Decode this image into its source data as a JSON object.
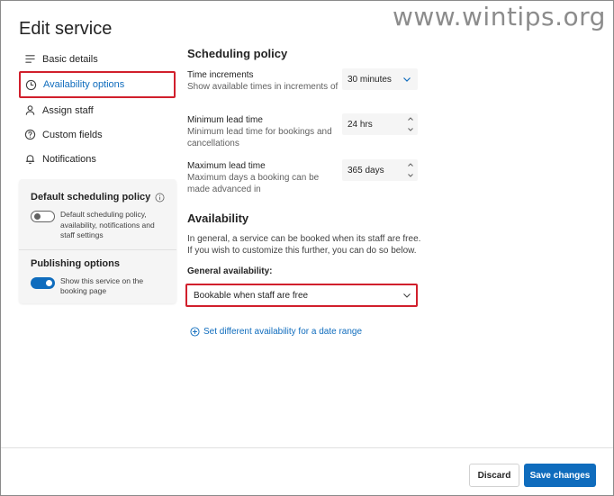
{
  "watermark": "www.wintips.org",
  "page_title": "Edit service",
  "nav": {
    "items": [
      {
        "label": "Basic details",
        "icon": "list-icon"
      },
      {
        "label": "Availability options",
        "icon": "clock-icon",
        "active": true
      },
      {
        "label": "Assign staff",
        "icon": "person-icon"
      },
      {
        "label": "Custom fields",
        "icon": "question-icon"
      },
      {
        "label": "Notifications",
        "icon": "bell-icon"
      }
    ]
  },
  "policy_card": {
    "default_title": "Default scheduling policy",
    "default_desc": "Default scheduling policy, availability, notifications and staff settings",
    "default_toggle": "off",
    "publishing_title": "Publishing options",
    "publishing_desc": "Show this service on the booking page",
    "publishing_toggle": "on"
  },
  "scheduling": {
    "heading": "Scheduling policy",
    "time_increments_label": "Time increments",
    "time_increments_desc": "Show available times in increments of",
    "time_increments_value": "30 minutes",
    "min_lead_label": "Minimum lead time",
    "min_lead_desc": "Minimum lead time for bookings and cancellations",
    "min_lead_value": "24 hrs",
    "max_lead_label": "Maximum lead time",
    "max_lead_desc": "Maximum days a booking can be made advanced in",
    "max_lead_value": "365 days"
  },
  "availability": {
    "heading": "Availability",
    "desc": "In general, a service can be booked when its staff are free. If you wish to customize this further, you can do so below.",
    "general_label": "General availability:",
    "general_value": "Bookable when staff are free",
    "date_range_link": "Set different availability for a date range"
  },
  "footer": {
    "discard": "Discard",
    "save": "Save changes"
  },
  "colors": {
    "accent": "#0f6cbd",
    "highlight": "#d11f2c"
  }
}
